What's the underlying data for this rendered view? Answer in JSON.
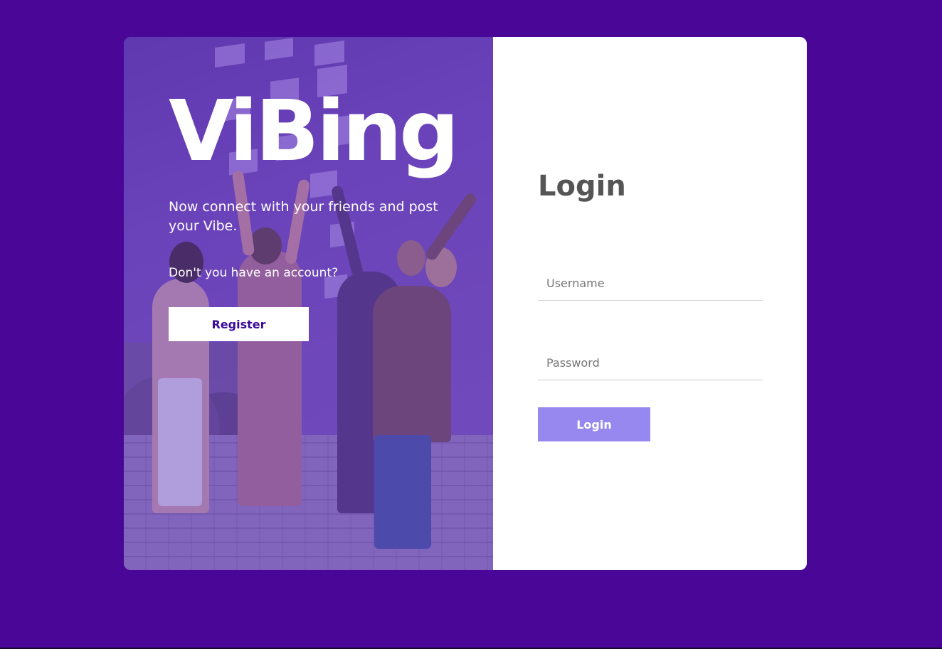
{
  "brand": {
    "name": "ViBing",
    "tagline": "Now connect with your friends and post your Vibe.",
    "account_question": "Don't you have an account?",
    "register_label": "Register"
  },
  "login": {
    "title": "Login",
    "username_placeholder": "Username",
    "password_placeholder": "Password",
    "submit_label": "Login"
  },
  "colors": {
    "page_background": "#4a0797",
    "register_text": "#3a0a98",
    "login_button": "#9688ee",
    "login_title": "#555555"
  },
  "hero_image": {
    "icon": "group-of-friends-photo"
  }
}
